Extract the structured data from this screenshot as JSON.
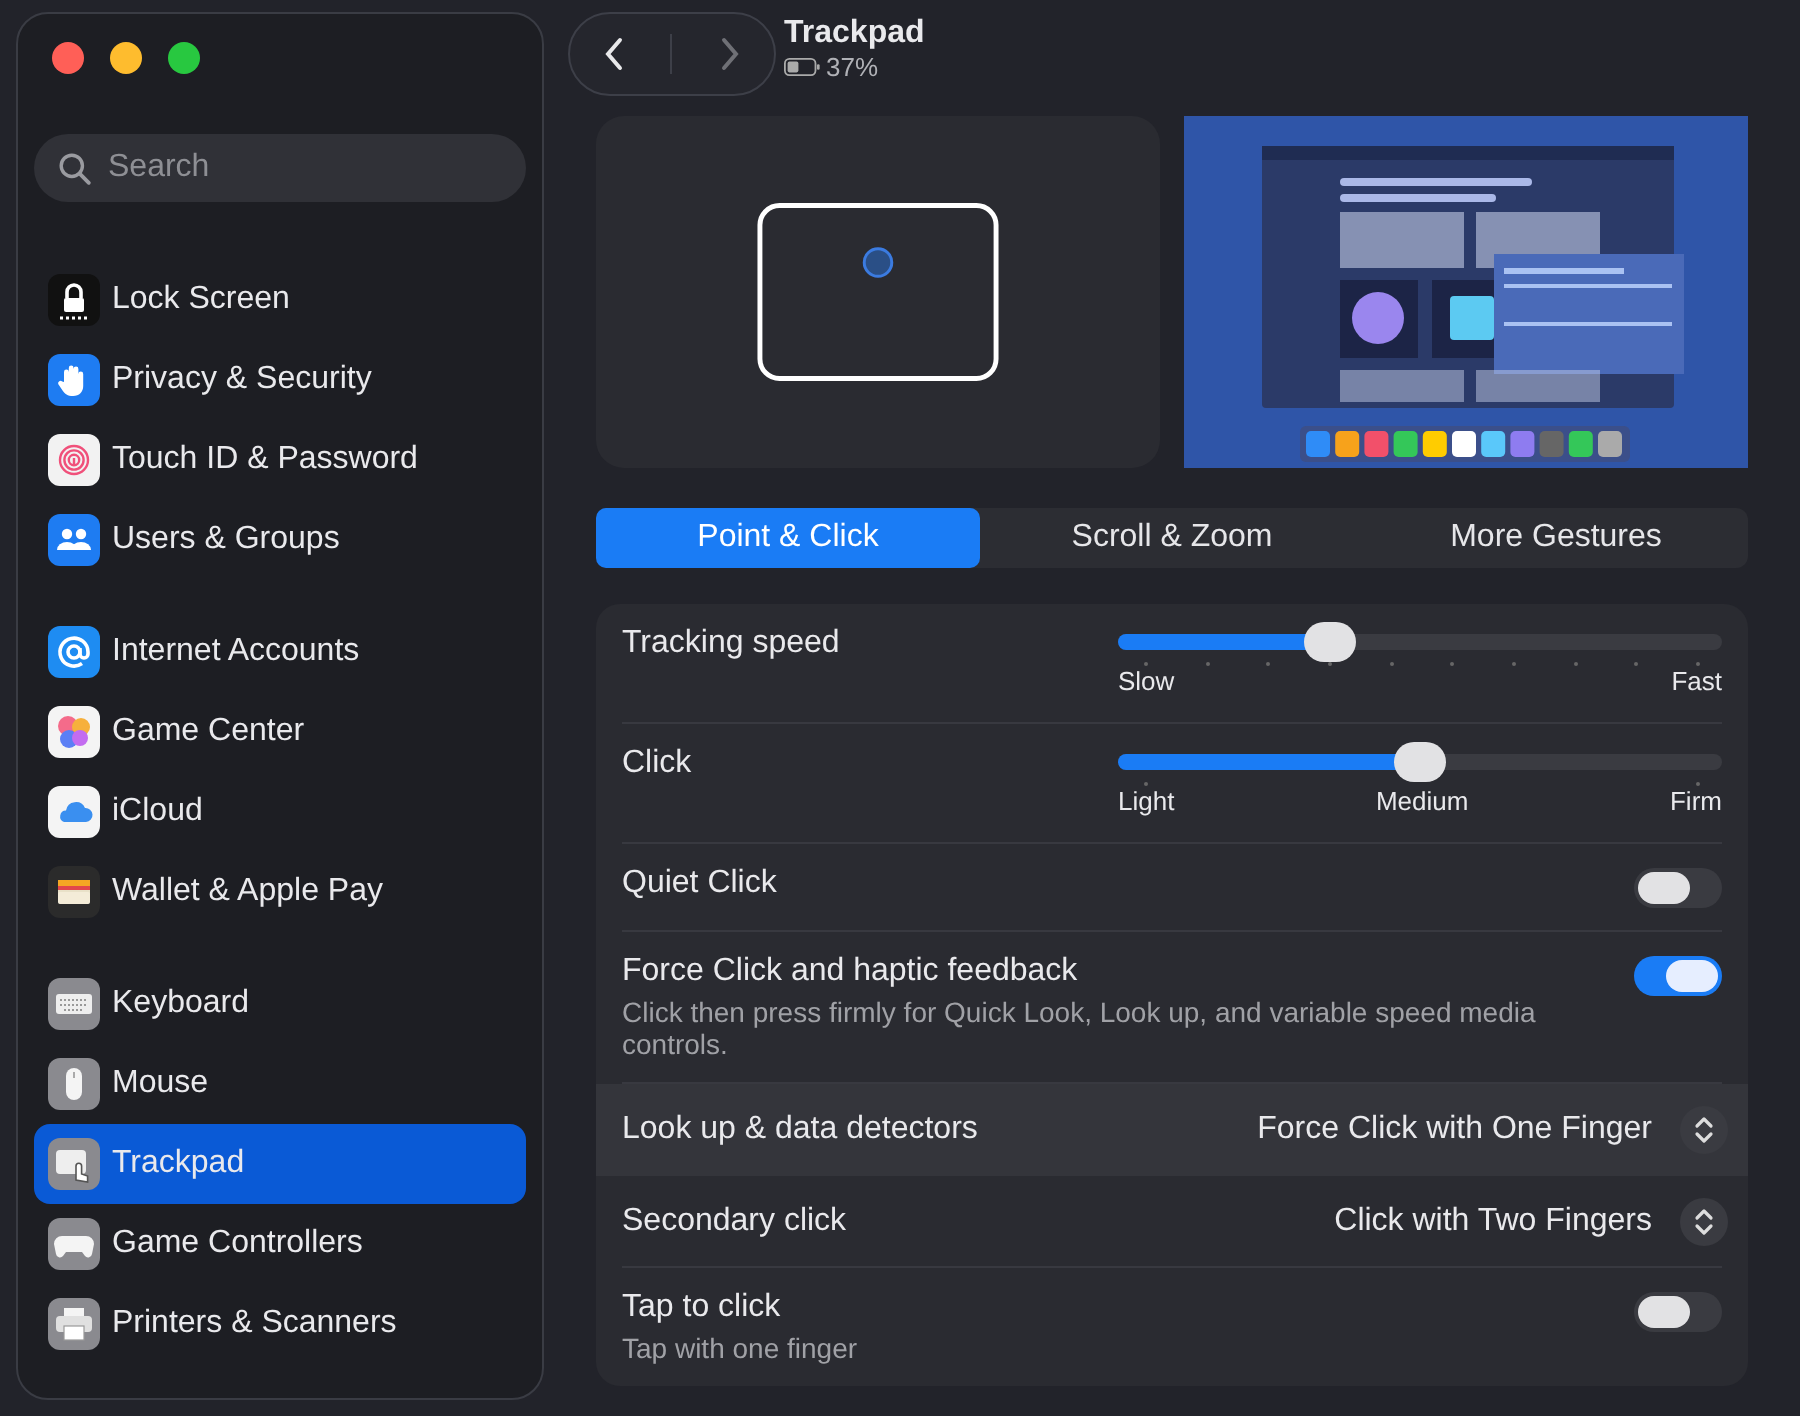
{
  "sidebar": {
    "search": {
      "placeholder": "Search"
    },
    "groups": [
      [
        {
          "label": "Lock Screen",
          "kind": "lock",
          "selected": false
        },
        {
          "label": "Privacy & Security",
          "kind": "hand",
          "selected": false
        },
        {
          "label": "Touch ID & Password",
          "kind": "fingerprint",
          "selected": false
        },
        {
          "label": "Users & Groups",
          "kind": "users",
          "selected": false
        }
      ],
      [
        {
          "label": "Internet Accounts",
          "kind": "at",
          "selected": false
        },
        {
          "label": "Game Center",
          "kind": "bubbles",
          "selected": false
        },
        {
          "label": "iCloud",
          "kind": "cloud",
          "selected": false
        },
        {
          "label": "Wallet & Apple Pay",
          "kind": "wallet",
          "selected": false
        }
      ],
      [
        {
          "label": "Keyboard",
          "kind": "keyboard",
          "selected": false
        },
        {
          "label": "Mouse",
          "kind": "mouse",
          "selected": false
        },
        {
          "label": "Trackpad",
          "kind": "trackpad",
          "selected": true
        },
        {
          "label": "Game Controllers",
          "kind": "gamepad",
          "selected": false
        },
        {
          "label": "Printers & Scanners",
          "kind": "printer",
          "selected": false
        }
      ]
    ]
  },
  "header": {
    "title": "Trackpad",
    "battery": "37%"
  },
  "tabs": [
    {
      "label": "Point & Click",
      "selected": true
    },
    {
      "label": "Scroll & Zoom",
      "selected": false
    },
    {
      "label": "More Gestures",
      "selected": false
    }
  ],
  "settings": [
    {
      "kind": "slider",
      "label": "Tracking speed",
      "level": 0.35,
      "marks": [
        "Slow",
        "Fast"
      ],
      "selected": false
    },
    {
      "kind": "slider",
      "label": "Click",
      "level": 0.5,
      "marks": [
        "Light",
        "Medium",
        "Firm"
      ],
      "selected": false
    },
    {
      "kind": "toggle",
      "label": "Quiet Click",
      "on": false,
      "selected": false
    },
    {
      "kind": "toggle",
      "label": "Force Click and haptic feedback",
      "note": "Click then press firmly for Quick Look, Look up, and variable speed media controls.",
      "on": true,
      "selected": false
    },
    {
      "kind": "popup",
      "label": "Look up & data detectors",
      "value": "Force Click with One Finger",
      "selected": true
    },
    {
      "kind": "popup",
      "label": "Secondary click",
      "value": "Click with Two Fingers",
      "selected": false
    },
    {
      "kind": "toggle",
      "label": "Tap to click",
      "note": "Tap with one finger",
      "on": false,
      "selected": false
    }
  ]
}
